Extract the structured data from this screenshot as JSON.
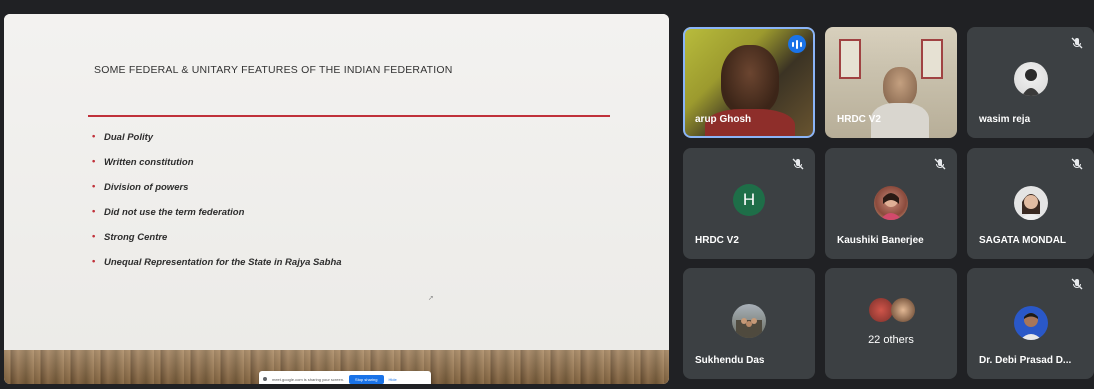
{
  "slide": {
    "title": "SOME FEDERAL & UNITARY FEATURES OF THE INDIAN FEDERATION",
    "bullets": [
      "Dual Polity",
      "Written constitution",
      "Division of powers",
      "Did not use the term federation",
      "Strong Centre",
      "Unequal Representation for the State in Rajya Sabha"
    ]
  },
  "share_bar": {
    "message": "meet.google.com is sharing your screen.",
    "stop_label": "Stop sharing",
    "hide_label": "Hide"
  },
  "participants": [
    {
      "name": "arup Ghosh",
      "state": "speaking",
      "view": "video"
    },
    {
      "name": "HRDC V2",
      "state": "unmuted",
      "view": "video"
    },
    {
      "name": "wasim reja",
      "state": "muted",
      "view": "avatar"
    },
    {
      "name": "HRDC V2",
      "state": "muted",
      "view": "letter",
      "letter": "H"
    },
    {
      "name": "Kaushiki Banerjee",
      "state": "muted",
      "view": "avatar"
    },
    {
      "name": "SAGATA MONDAL",
      "state": "muted",
      "view": "avatar"
    },
    {
      "name": "Sukhendu Das",
      "state": "unmuted",
      "view": "avatar"
    },
    {
      "name": "22 others",
      "state": "group",
      "view": "avatars"
    },
    {
      "name": "Dr. Debi Prasad D...",
      "state": "muted",
      "view": "avatar"
    }
  ],
  "colors": {
    "background": "#202124",
    "tile": "#3c4043",
    "accent_rule": "#c0313a",
    "speaking_blue": "#1a73e8",
    "letter_avatar": "#1e6e48"
  }
}
